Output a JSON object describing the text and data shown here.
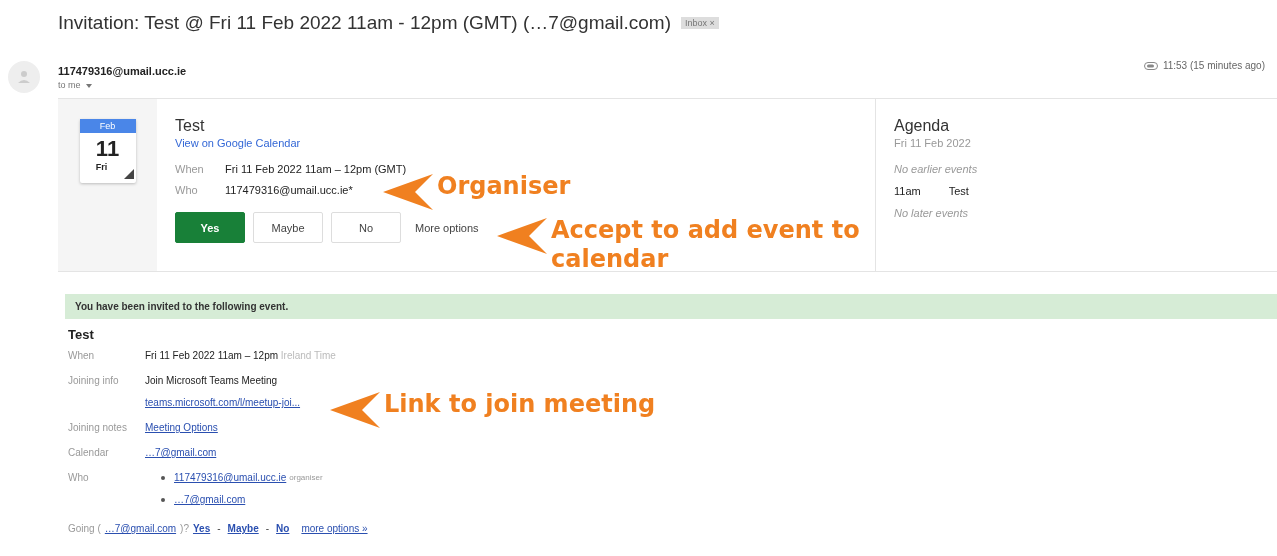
{
  "subject": {
    "title": "Invitation: Test @ Fri 11 Feb 2022 11am - 12pm (GMT) (…7@gmail.com)",
    "label": "Inbox ×"
  },
  "sender": {
    "email": "117479316@umail.ucc.ie",
    "to": "to me",
    "time": "11:53 (15 minutes ago)"
  },
  "invite_card": {
    "calendar_month": "Feb",
    "calendar_day": "11",
    "calendar_weekday": "Fri",
    "title": "Test",
    "view_link": "View on Google Calendar",
    "fields": [
      {
        "label": "When",
        "value": "Fri 11 Feb 2022 11am – 12pm (GMT)"
      },
      {
        "label": "Who",
        "value": "117479316@umail.ucc.ie*"
      }
    ],
    "rsvp_buttons": [
      {
        "label": "Yes",
        "selected": true
      },
      {
        "label": "Maybe",
        "selected": false
      },
      {
        "label": "No",
        "selected": false
      }
    ],
    "more_options": "More options"
  },
  "agenda": {
    "title": "Agenda",
    "date": "Fri 11 Feb 2022",
    "before": "No earlier events",
    "events": [
      {
        "time": "11am",
        "title": "Test"
      }
    ],
    "after": "No later events"
  },
  "banner": "You have been invited to the following event.",
  "details": {
    "title": "Test",
    "when_label": "When",
    "when": "Fri 11 Feb 2022 11am – 12pm",
    "when_zone": "Ireland Time",
    "joining_label": "Joining info",
    "joining_text": "Join Microsoft Teams Meeting",
    "joining_link": "teams.microsoft.com/l/meetup-joi...",
    "notes_label": "Joining notes",
    "notes_link": "Meeting Options",
    "calendar_label": "Calendar",
    "calendar_link": "…7@gmail.com",
    "who_label": "Who",
    "guests": [
      {
        "email": "117479316@umail.ucc.ie",
        "role": "organiser"
      },
      {
        "email": "…7@gmail.com"
      }
    ],
    "going_prefix": "Going (",
    "going_email": "…7@gmail.com",
    "going_suffix": ")?",
    "going_links": [
      "Yes",
      "-",
      "Maybe",
      "-",
      "No"
    ],
    "going_more": "more options »"
  },
  "annotations": [
    {
      "text": "Organiser"
    },
    {
      "text": "Accept to add event to calendar"
    },
    {
      "text": "Link to join meeting"
    }
  ]
}
